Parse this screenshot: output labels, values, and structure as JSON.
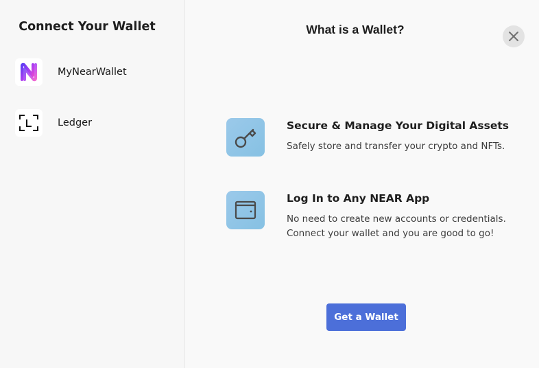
{
  "sidebar": {
    "title": "Connect Your Wallet",
    "wallets": [
      {
        "label": "MyNearWallet",
        "icon": "mynearwallet-logo-icon"
      },
      {
        "label": "Ledger",
        "icon": "ledger-logo-icon"
      }
    ]
  },
  "main": {
    "title": "What is a Wallet?",
    "close_icon": "close-icon",
    "features": [
      {
        "icon": "key-icon",
        "title": "Secure & Manage Your Digital Assets",
        "description": "Safely store and transfer your crypto and NFTs."
      },
      {
        "icon": "wallet-icon",
        "title": "Log In to Any NEAR App",
        "description": "No need to create new accounts or credentials. Connect your wallet and you are good to go!"
      }
    ],
    "cta_label": "Get a Wallet"
  },
  "colors": {
    "accent": "#4c6fd9",
    "feature_icon_bg": "#8fc4e6",
    "close_bg": "#e3e3e3"
  }
}
